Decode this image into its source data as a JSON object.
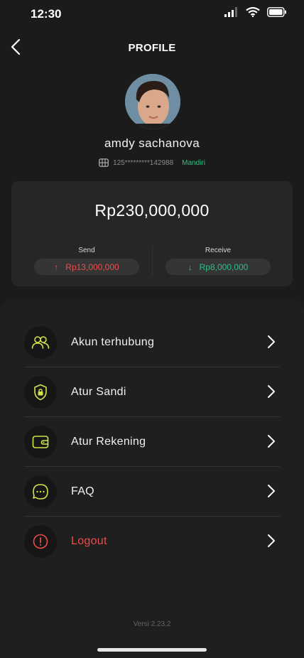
{
  "status": {
    "time": "12:30"
  },
  "header": {
    "title": "PROFILE"
  },
  "profile": {
    "name": "amdy sachanova",
    "account_number": "125*********142988",
    "bank": "Mandiri"
  },
  "balance": {
    "amount": "Rp230,000,000",
    "send": {
      "label": "Send",
      "arrow": "↑",
      "value": "Rp13,000,000"
    },
    "receive": {
      "label": "Receive",
      "arrow": "↓",
      "value": "Rp8,000,000"
    }
  },
  "menu": {
    "items": [
      {
        "label": "Akun terhubung",
        "icon": "users-icon"
      },
      {
        "label": "Atur Sandi",
        "icon": "shield-lock-icon"
      },
      {
        "label": "Atur Rekening",
        "icon": "wallet-icon"
      },
      {
        "label": "FAQ",
        "icon": "chat-bubble-icon"
      },
      {
        "label": "Logout",
        "icon": "alert-circle-icon"
      }
    ]
  },
  "footer": {
    "version": "Versi 2.23.2"
  },
  "colors": {
    "background": "#1b1b1b",
    "card": "#262626",
    "accent_lime": "#d4e34a",
    "send_red": "#ef4b4b",
    "receive_green": "#2fbf84",
    "logout_red": "#ef4b4b"
  }
}
